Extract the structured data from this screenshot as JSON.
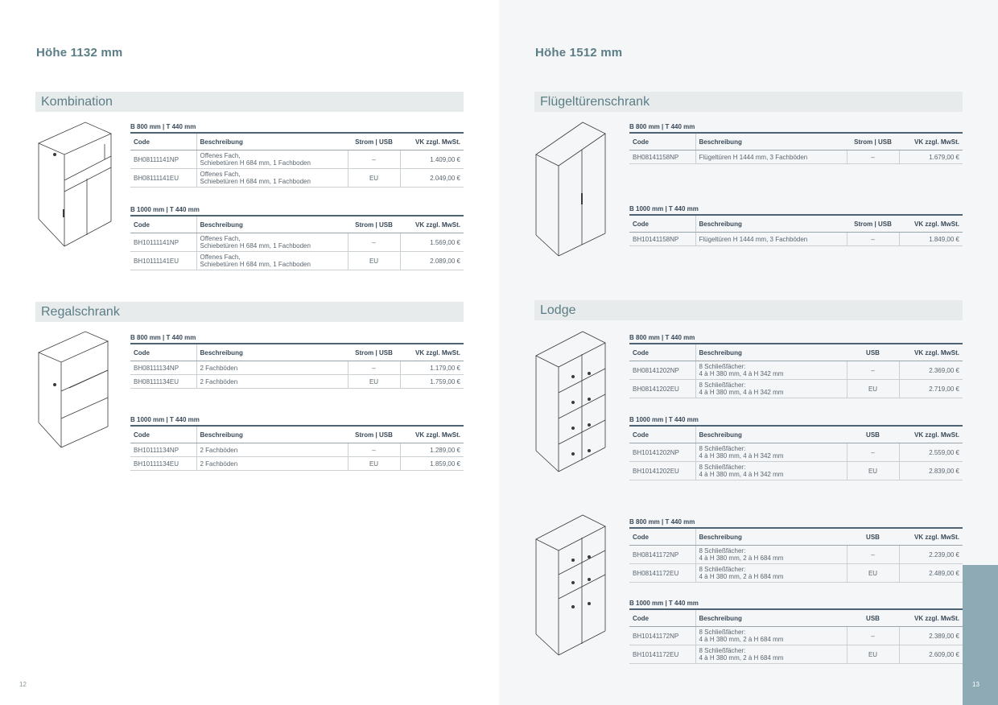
{
  "left": {
    "title": "Höhe 1132 mm",
    "page_number": "12",
    "sections": [
      {
        "label": "Kombination",
        "blocks": [
          {
            "dims": "B 800 mm | T 440 mm",
            "rows": [
              {
                "code": "BH08111141NP",
                "desc1": "Offenes Fach,",
                "desc2": "Schiebetüren H 684 mm, 1 Fachboden",
                "opt": "–",
                "price": "1.409,00 €"
              },
              {
                "code": "BH08111141EU",
                "desc1": "Offenes Fach,",
                "desc2": "Schiebetüren H 684 mm, 1 Fachboden",
                "opt": "EU",
                "price": "2.049,00 €"
              }
            ]
          },
          {
            "dims": "B 1000 mm | T 440 mm",
            "rows": [
              {
                "code": "BH10111141NP",
                "desc1": "Offenes Fach,",
                "desc2": "Schiebetüren H 684 mm, 1 Fachboden",
                "opt": "–",
                "price": "1.569,00 €"
              },
              {
                "code": "BH10111141EU",
                "desc1": "Offenes Fach,",
                "desc2": "Schiebetüren H 684 mm, 1 Fachboden",
                "opt": "EU",
                "price": "2.089,00 €"
              }
            ]
          }
        ]
      },
      {
        "label": "Regalschrank",
        "blocks": [
          {
            "dims": "B 800 mm | T 440 mm",
            "rows": [
              {
                "code": "BH08111134NP",
                "desc1": "2 Fachböden",
                "opt": "–",
                "price": "1.179,00 €"
              },
              {
                "code": "BH08111134EU",
                "desc1": "2 Fachböden",
                "opt": "EU",
                "price": "1.759,00 €"
              }
            ]
          },
          {
            "dims": "B 1000 mm | T 440 mm",
            "rows": [
              {
                "code": "BH10111134NP",
                "desc1": "2 Fachböden",
                "opt": "–",
                "price": "1.289,00 €"
              },
              {
                "code": "BH10111134EU",
                "desc1": "2 Fachböden",
                "opt": "EU",
                "price": "1.859,00 €"
              }
            ]
          }
        ]
      }
    ]
  },
  "right": {
    "title": "Höhe 1512 mm",
    "page_number": "13",
    "sections": [
      {
        "label": "Flügeltürenschrank",
        "blocks": [
          {
            "dims": "B 800 mm | T 440 mm",
            "rows": [
              {
                "code": "BH08141158NP",
                "desc1": "Flügeltüren H 1444 mm, 3 Fachböden",
                "opt": "–",
                "price": "1.679,00 €"
              }
            ]
          },
          {
            "dims": "B 1000 mm | T 440 mm",
            "rows": [
              {
                "code": "BH10141158NP",
                "desc1": "Flügeltüren H 1444 mm, 3 Fachböden",
                "opt": "–",
                "price": "1.849,00 €"
              }
            ]
          }
        ]
      },
      {
        "label": "Lodge",
        "blocks": [
          {
            "dims": "B 800 mm | T 440 mm",
            "rows": [
              {
                "code": "BH08141202NP",
                "desc1": "8 Schließfächer:",
                "desc2": "4 à H 380 mm, 4 à H 342 mm",
                "opt": "–",
                "price": "2.369,00 €"
              },
              {
                "code": "BH08141202EU",
                "desc1": "8 Schließfächer:",
                "desc2": "4 à H 380 mm, 4 à H 342 mm",
                "opt": "EU",
                "price": "2.719,00 €"
              }
            ]
          },
          {
            "dims": "B 1000 mm | T 440 mm",
            "rows": [
              {
                "code": "BH10141202NP",
                "desc1": "8 Schließfächer:",
                "desc2": "4 à H 380 mm, 4 à H 342 mm",
                "opt": "–",
                "price": "2.559,00 €"
              },
              {
                "code": "BH10141202EU",
                "desc1": "8 Schließfächer:",
                "desc2": "4 à H 380 mm, 4 à H 342 mm",
                "opt": "EU",
                "price": "2.839,00 €"
              }
            ]
          },
          {
            "dims": "B 800 mm | T 440 mm",
            "rows": [
              {
                "code": "BH08141172NP",
                "desc1": "8 Schließfächer:",
                "desc2": "4 à H 380 mm, 2 à H 684 mm",
                "opt": "–",
                "price": "2.239,00 €"
              },
              {
                "code": "BH08141172EU",
                "desc1": "8 Schließfächer:",
                "desc2": "4 à H 380 mm, 2 à H 684 mm",
                "opt": "EU",
                "price": "2.489,00 €"
              }
            ]
          },
          {
            "dims": "B 1000 mm | T 440 mm",
            "rows": [
              {
                "code": "BH10141172NP",
                "desc1": "8 Schließfächer:",
                "desc2": "4 à H 380 mm, 2 à H 684 mm",
                "opt": "–",
                "price": "2.389,00 €"
              },
              {
                "code": "BH10141172EU",
                "desc1": "8 Schließfächer:",
                "desc2": "4 à H 380 mm, 2 à H 684 mm",
                "opt": "EU",
                "price": "2.609,00 €"
              }
            ]
          }
        ]
      }
    ]
  },
  "headers": {
    "code": "Code",
    "desc": "Beschreibung",
    "strom_usb": "Strom | USB",
    "usb": "USB",
    "price": "VK zzgl. MwSt."
  }
}
